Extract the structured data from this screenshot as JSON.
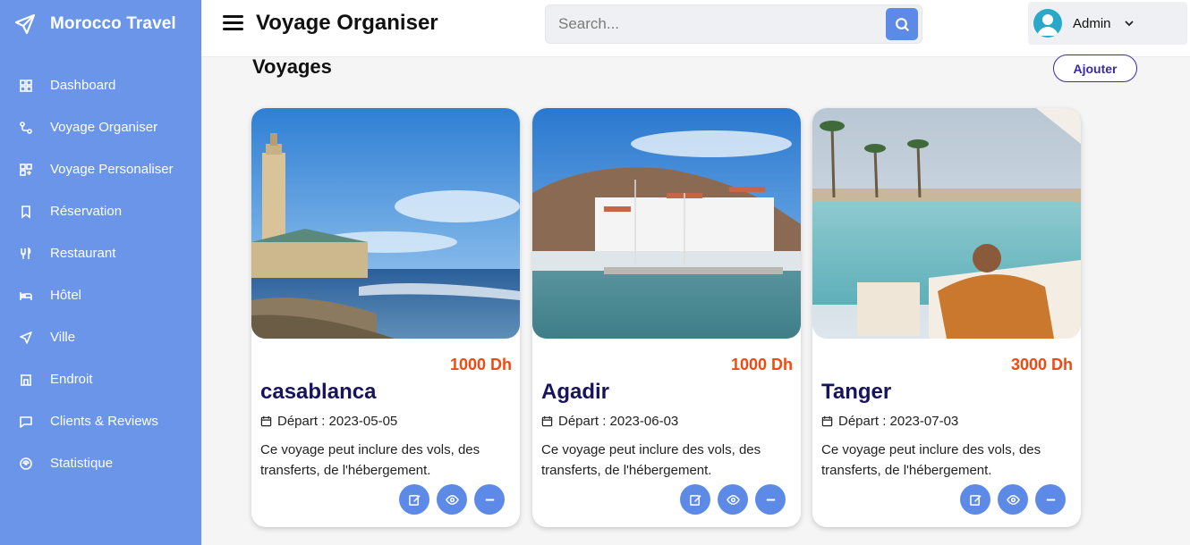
{
  "brand": {
    "name": "Morocco Travel",
    "icon": "paper-plane-icon"
  },
  "sidebar": {
    "items": [
      {
        "label": "Dashboard",
        "icon": "grid-icon"
      },
      {
        "label": "Voyage Organiser",
        "icon": "route-icon"
      },
      {
        "label": "Voyage Personaliser",
        "icon": "grid-plus-icon"
      },
      {
        "label": "Réservation",
        "icon": "bookmark-icon"
      },
      {
        "label": "Restaurant",
        "icon": "utensils-icon"
      },
      {
        "label": "Hôtel",
        "icon": "bed-icon"
      },
      {
        "label": "Ville",
        "icon": "send-icon"
      },
      {
        "label": "Endroit",
        "icon": "building-icon"
      },
      {
        "label": "Clients & Reviews",
        "icon": "chat-icon"
      },
      {
        "label": "Statistique",
        "icon": "chart-icon"
      }
    ]
  },
  "header": {
    "title": "Voyage Organiser",
    "search_placeholder": "Search...",
    "user_name": "Admin"
  },
  "main": {
    "section_title": "Voyages",
    "add_label": "Ajouter",
    "cards": [
      {
        "city": "casablanca",
        "price": "1000 Dh",
        "date": "Départ : 2023-05-05",
        "description": "Ce voyage peut inclure des vols, des transferts, de l'hébergement."
      },
      {
        "city": "Agadir",
        "price": "1000 Dh",
        "date": "Départ : 2023-06-03",
        "description": "Ce voyage peut inclure des vols, des transferts, de l'hébergement."
      },
      {
        "city": "Tanger",
        "price": "3000 Dh",
        "date": "Départ : 2023-07-03",
        "description": "Ce voyage peut inclure des vols, des transferts, de l'hébergement."
      }
    ]
  },
  "colors": {
    "sidebar": "#6a95e8",
    "accent": "#5c8ae6",
    "price": "#ef4a12",
    "city": "#18135e",
    "add_border": "#3a2aa8"
  }
}
